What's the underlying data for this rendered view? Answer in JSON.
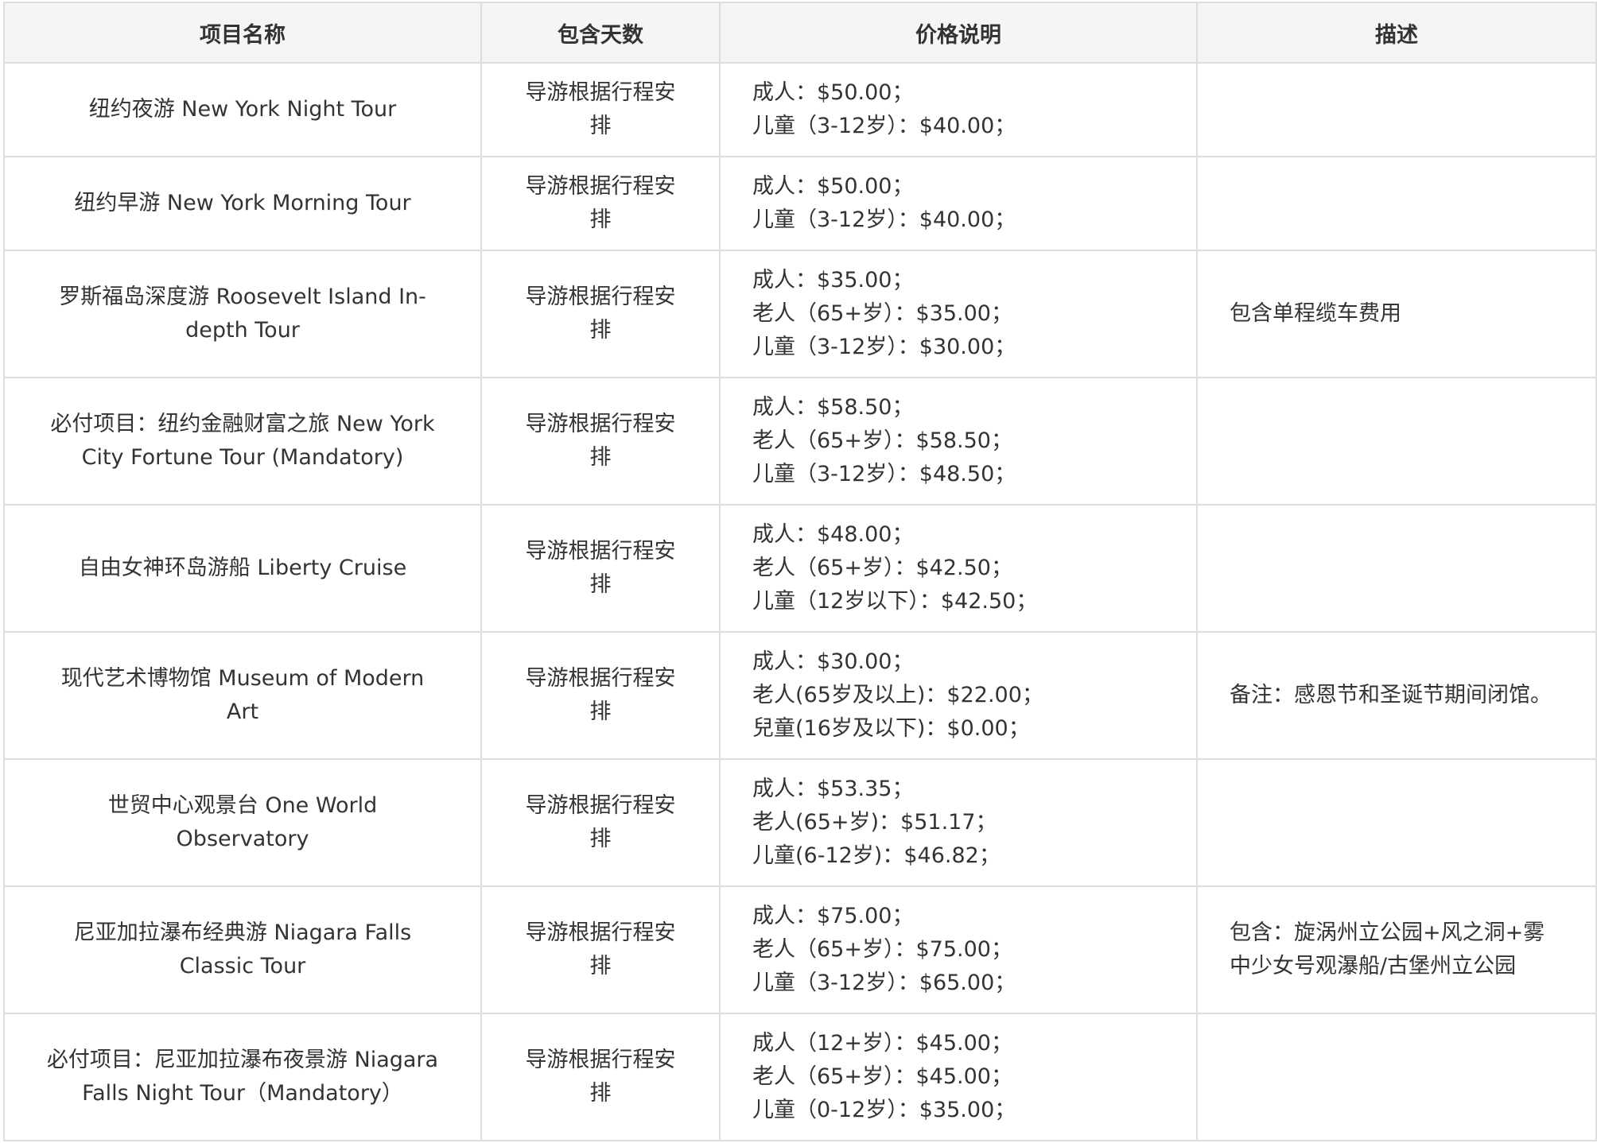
{
  "table": {
    "headers": [
      "项目名称",
      "包含天数",
      "价格说明",
      "描述"
    ],
    "rows": [
      {
        "name": "纽约夜游 New York Night Tour",
        "days": "导游根据行程安排",
        "prices": [
          "成人：$50.00；",
          "儿童（3-12岁）：$40.00；"
        ],
        "desc": ""
      },
      {
        "name": "纽约早游 New York Morning Tour",
        "days": "导游根据行程安排",
        "prices": [
          "成人：$50.00；",
          "儿童（3-12岁）：$40.00；"
        ],
        "desc": ""
      },
      {
        "name": "罗斯福岛深度游 Roosevelt Island In-depth Tour",
        "days": "导游根据行程安排",
        "prices": [
          "成人：$35.00；",
          "老人（65+岁）：$35.00；",
          "儿童（3-12岁）：$30.00；"
        ],
        "desc": "包含单程缆车费用"
      },
      {
        "name": "必付项目：纽约金融财富之旅 New York City Fortune Tour (Mandatory)",
        "days": "导游根据行程安排",
        "prices": [
          "成人：$58.50；",
          "老人（65+岁）：$58.50；",
          "儿童（3-12岁）：$48.50；"
        ],
        "desc": ""
      },
      {
        "name": "自由女神环岛游船 Liberty Cruise",
        "days": "导游根据行程安排",
        "prices": [
          "成人：$48.00；",
          "老人（65+岁）：$42.50；",
          "儿童（12岁以下）：$42.50；"
        ],
        "desc": ""
      },
      {
        "name": "现代艺术博物馆 Museum of Modern Art",
        "days": "导游根据行程安排",
        "prices": [
          "成人：$30.00；",
          "老人(65岁及以上)：$22.00；",
          "兒童(16岁及以下)：$0.00；"
        ],
        "desc": "备注：感恩节和圣诞节期间闭馆。"
      },
      {
        "name": "世贸中心观景台 One World Observatory",
        "days": "导游根据行程安排",
        "prices": [
          "成人：$53.35；",
          "老人(65+岁)：$51.17；",
          "儿童(6-12岁)：$46.82；"
        ],
        "desc": ""
      },
      {
        "name": "尼亚加拉瀑布经典游 Niagara Falls Classic Tour",
        "days": "导游根据行程安排",
        "prices": [
          "成人：$75.00；",
          "老人（65+岁）：$75.00；",
          "儿童（3-12岁）：$65.00；"
        ],
        "desc": "包含：旋涡州立公园+风之洞+雾中少女号观瀑船/古堡州立公园"
      },
      {
        "name": "必付项目：尼亚加拉瀑布夜景游 Niagara Falls Night Tour（Mandatory）",
        "days": "导游根据行程安排",
        "prices": [
          "成人（12+岁）：$45.00；",
          "老人（65+岁）：$45.00；",
          "儿童（0-12岁）：$35.00；"
        ],
        "desc": ""
      }
    ]
  }
}
